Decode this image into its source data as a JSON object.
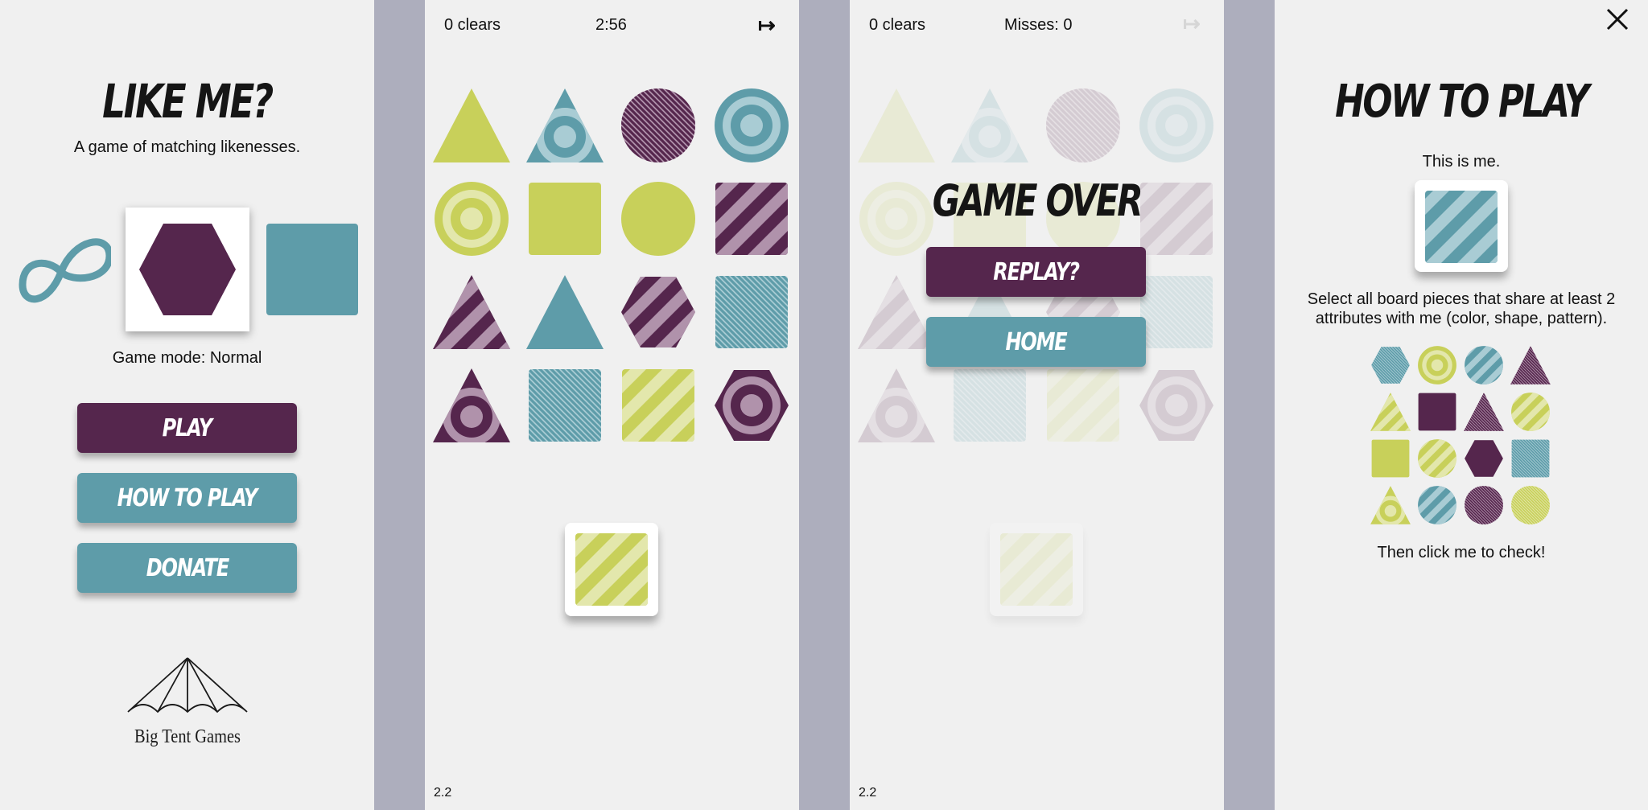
{
  "menu": {
    "title": "LIKE ME?",
    "subtitle": "A game of matching likenesses.",
    "game_mode": "Game mode: Normal",
    "buttons": {
      "play": "PLAY",
      "how_to_play": "HOW TO PLAY",
      "donate": "DONATE"
    },
    "logo_text": "Big Tent Games",
    "mode_selector": [
      {
        "icon": "infinity-icon",
        "color": "teal"
      },
      {
        "icon": "hexagon-icon",
        "color": "purple",
        "selected": true
      },
      {
        "icon": "square-icon",
        "color": "teal"
      }
    ]
  },
  "game": {
    "clears": "0 clears",
    "timer": "2:56",
    "exit_icon": "exit-arrow-icon",
    "version": "2.2",
    "board": [
      {
        "shape": "triangle",
        "color": "lime",
        "pattern": "solid"
      },
      {
        "shape": "triangle",
        "color": "teal",
        "pattern": "rings"
      },
      {
        "shape": "circle",
        "color": "purple",
        "pattern": "fine-stripes"
      },
      {
        "shape": "circle",
        "color": "teal",
        "pattern": "rings"
      },
      {
        "shape": "circle",
        "color": "lime",
        "pattern": "rings"
      },
      {
        "shape": "square",
        "color": "lime",
        "pattern": "solid"
      },
      {
        "shape": "circle",
        "color": "lime",
        "pattern": "solid"
      },
      {
        "shape": "square",
        "color": "purple",
        "pattern": "stripes"
      },
      {
        "shape": "triangle",
        "color": "purple",
        "pattern": "stripes"
      },
      {
        "shape": "triangle",
        "color": "teal",
        "pattern": "solid"
      },
      {
        "shape": "hexagon",
        "color": "purple",
        "pattern": "stripes"
      },
      {
        "shape": "square",
        "color": "teal",
        "pattern": "fine-stripes"
      },
      {
        "shape": "triangle",
        "color": "purple",
        "pattern": "rings"
      },
      {
        "shape": "square",
        "color": "teal",
        "pattern": "fine-stripes"
      },
      {
        "shape": "square",
        "color": "lime",
        "pattern": "stripes"
      },
      {
        "shape": "hexagon",
        "color": "purple",
        "pattern": "rings"
      }
    ],
    "target": {
      "shape": "square",
      "color": "lime",
      "pattern": "stripes"
    }
  },
  "game_over": {
    "clears": "0 clears",
    "misses": "Misses: 0",
    "title": "GAME OVER",
    "buttons": {
      "replay": "REPLAY?",
      "home": "HOME"
    },
    "version": "2.2"
  },
  "how_to_play": {
    "title": "HOW TO PLAY",
    "this_is_me": "This is me.",
    "instructions": "Select all board pieces that share at least 2 attributes with me (color, shape, pattern).",
    "then_click": "Then click me to check!",
    "example_target": {
      "shape": "square",
      "color": "teal",
      "pattern": "stripes"
    },
    "example_board": [
      {
        "shape": "hexagon",
        "color": "teal",
        "pattern": "fine-stripes"
      },
      {
        "shape": "circle",
        "color": "lime",
        "pattern": "rings"
      },
      {
        "shape": "circle",
        "color": "teal",
        "pattern": "stripes"
      },
      {
        "shape": "triangle",
        "color": "purple",
        "pattern": "fine-stripes"
      },
      {
        "shape": "triangle",
        "color": "lime",
        "pattern": "stripes"
      },
      {
        "shape": "square",
        "color": "purple",
        "pattern": "solid"
      },
      {
        "shape": "triangle",
        "color": "purple",
        "pattern": "fine-stripes"
      },
      {
        "shape": "circle",
        "color": "lime",
        "pattern": "stripes"
      },
      {
        "shape": "square",
        "color": "lime",
        "pattern": "solid"
      },
      {
        "shape": "circle",
        "color": "lime",
        "pattern": "stripes"
      },
      {
        "shape": "hexagon",
        "color": "purple",
        "pattern": "solid"
      },
      {
        "shape": "square",
        "color": "teal",
        "pattern": "fine-stripes"
      },
      {
        "shape": "triangle",
        "color": "lime",
        "pattern": "rings"
      },
      {
        "shape": "circle",
        "color": "teal",
        "pattern": "stripes"
      },
      {
        "shape": "circle",
        "color": "purple",
        "pattern": "fine-stripes"
      },
      {
        "shape": "circle",
        "color": "lime",
        "pattern": "fine-stripes"
      }
    ],
    "close_icon": "close-icon"
  },
  "colors": {
    "purple": "#55264d",
    "teal": "#5e9ca9",
    "lime": "#c8d05a",
    "panel": "#f0f0f0",
    "gutter": "#adaebd"
  }
}
